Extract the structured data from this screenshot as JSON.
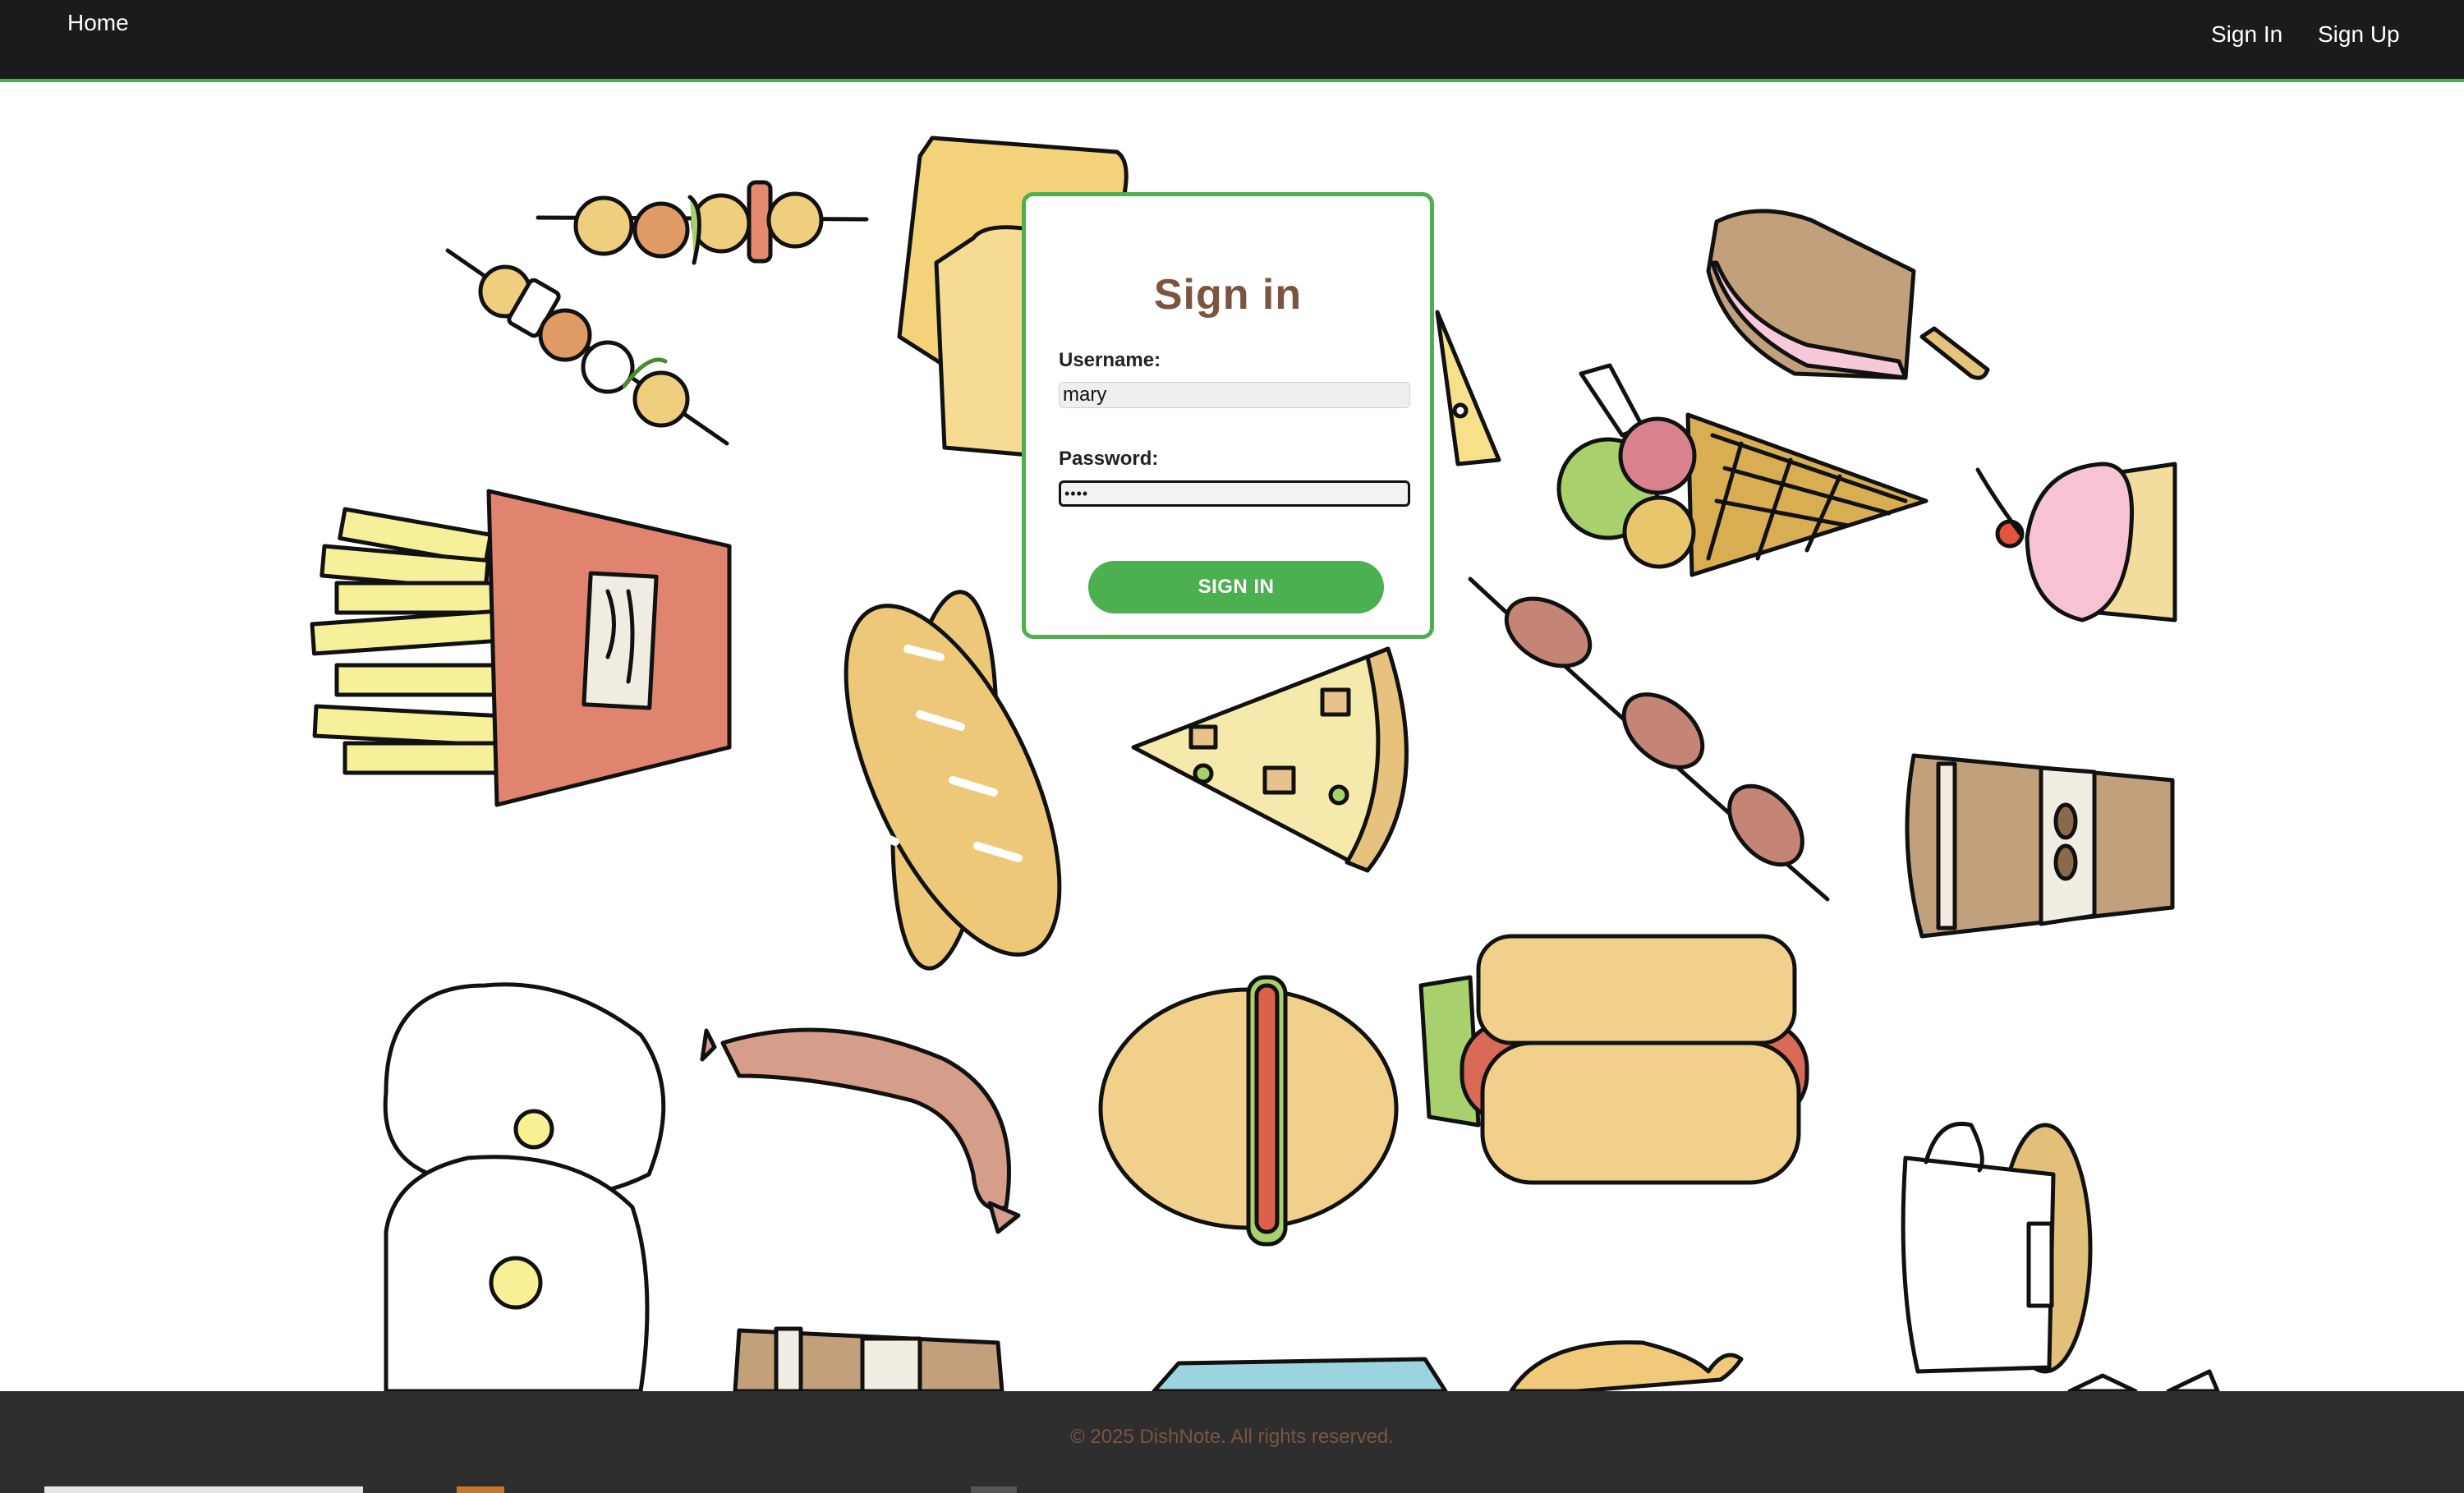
{
  "nav": {
    "home_label": "Home",
    "signin_label": "Sign In",
    "signup_label": "Sign Up"
  },
  "form": {
    "title": "Sign in",
    "username_label": "Username:",
    "username_value": "mary",
    "password_label": "Password:",
    "password_value": "••••",
    "submit_label": "SIGN IN"
  },
  "footer": {
    "copyright": "© 2025 DishNote. All rights reserved."
  },
  "colors": {
    "accent": "#4caf50",
    "title_brown": "#7a5541",
    "nav_bg": "#1b1b1b",
    "footer_bg": "#2e2e2e"
  },
  "background_icons": [
    "skewer-icon",
    "toast-icon",
    "cheese-icon",
    "popsicle-icon",
    "ice-cream-cone-icon",
    "cupcake-icon",
    "fries-icon",
    "baguette-icon",
    "pizza-slice-icon",
    "sausage-skewer-icon",
    "coffee-cup-icon",
    "fried-eggs-icon",
    "sausage-icon",
    "burger-icon",
    "hotdog-icon",
    "teacup-icon",
    "coffee-box-icon",
    "milk-carton-icon",
    "chicken-leg-icon"
  ]
}
